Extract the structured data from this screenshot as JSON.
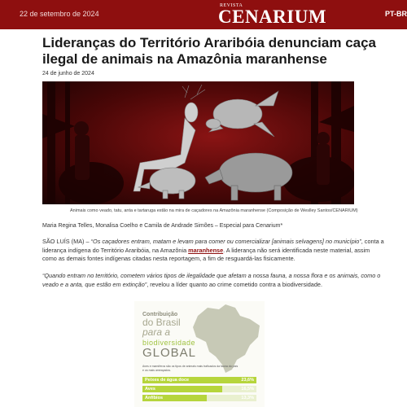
{
  "header": {
    "date": "22 de setembro de 2024",
    "logo_small": "REVISTA",
    "logo_big": "CENARIUM",
    "language": "PT-BR"
  },
  "article": {
    "title": "Lideranças do Território Araribóia denunciam caça ilegal de animais na Amazônia maranhense",
    "date": "24 de junho de 2024",
    "image_caption": "Animais como veado, tatu, anta e tartaruga estão na mira de caçadores na Amazônia maranhense (Composição de Weslley Santos/CENARIUM)",
    "authors": "Maria Regina Telles, Monalisa Coelho e Camila de Andrade Simões – Especial para Cenarium*",
    "p1_lead": "SÃO LUÍS (MA) – ",
    "p1_quote": "“Os caçadores entram, matam e levam para comer ou comercializar [animais selvagens] no município”",
    "p1_mid": ", conta a liderança indígena do Território Araribóia, na Amazônia ",
    "p1_link": "maranhense",
    "p1_tail": ". A liderança não será identificada neste material, assim como as demais fontes indígenas citadas nesta reportagem, a fim de resguardá-las fisicamente.",
    "p2_quote": "“Quando entram no território, cometem vários tipos de ilegalidade que afetam a nossa fauna, a nossa flora e os animais, como o veado e a anta, que estão em extinção”",
    "p2_tail": ", revelou a líder quanto ao crime cometido contra a biodiversidade."
  },
  "infographic": {
    "line1": "Contribuição",
    "line2": "do Brasil",
    "line3": "para a",
    "line4": "biodiversidade",
    "line5": "GLOBAL",
    "description": "Aves e mamíferos são os tipos de animais mais traficados da fauna do país e os mais ameaçados.",
    "rows": [
      {
        "label": "Peixes de água doce",
        "value": "23,6%",
        "fraction": 0.236
      },
      {
        "label": "Aves",
        "value": "16,5%",
        "fraction": 0.165
      },
      {
        "label": "Anfíbios",
        "value": "13,3%",
        "fraction": 0.133
      }
    ],
    "accent": "#b6d53c"
  },
  "colors": {
    "brand": "#8e0f0f",
    "link": "#8e0f0f"
  }
}
